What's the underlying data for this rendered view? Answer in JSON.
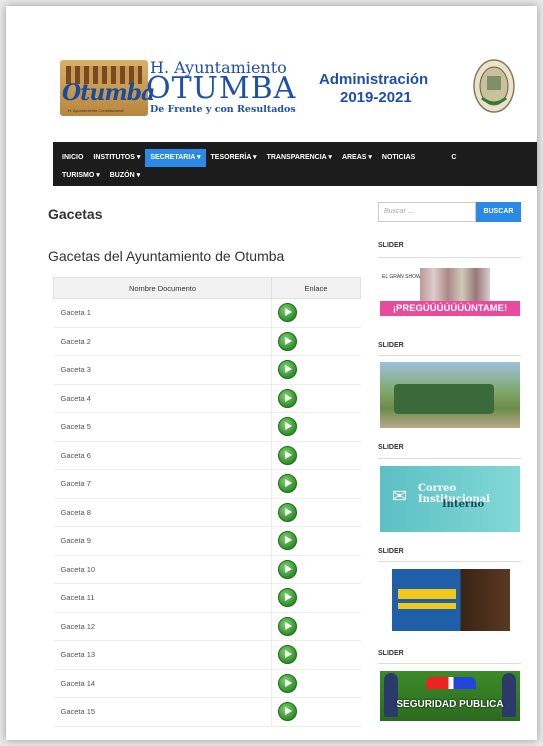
{
  "header": {
    "logo_script": "Otumba",
    "logo_small": "H. Ayuntamiento Constitucional",
    "ayuntamiento_line1": "H. Ayuntamiento",
    "ayuntamiento_line2": "OTUMBA",
    "ayuntamiento_slogan": "De Frente y con Resultados",
    "admin_line1": "Administración",
    "admin_line2": "2019-2021"
  },
  "nav": {
    "row1": [
      "INICIO",
      "INSTITUTOS ▾",
      "SECRETARIA ▾",
      "TESORERÍA ▾",
      "TRANSPARENCIA ▾",
      "AREAS ▾",
      "NOTICIAS",
      "C"
    ],
    "row2": [
      "TURISMO ▾",
      "BUZÓN ▾"
    ],
    "active": "SECRETARIA ▾"
  },
  "main": {
    "title": "Gacetas",
    "subtitle": "Gacetas del Ayuntamiento de Otumba",
    "table": {
      "headers": [
        "Nombre Documento",
        "Enlace"
      ],
      "rows": [
        "Gaceta 1",
        "Gaceta 2",
        "Gaceta 3",
        "Gaceta 4",
        "Gaceta 5",
        "Gaceta 6",
        "Gaceta 7",
        "Gaceta 8",
        "Gaceta 9",
        "Gaceta 10",
        "Gaceta 11",
        "Gaceta 12",
        "Gaceta 13",
        "Gaceta 14",
        "Gaceta 15"
      ]
    }
  },
  "sidebar": {
    "search_placeholder": "Buscar ...",
    "search_button": "BUSCAR",
    "slider_label": "SLIDER",
    "banner1_text": "EL GRAN SHOW PARA SABER",
    "banner1_bar": "¡PREGÚÚÚÚÚÚÚNTAME!",
    "banner3_line1": "Correo Institucional",
    "banner3_line2": "Interno",
    "banner5_text": "SEGURIDAD PUBLICA"
  },
  "colors": {
    "accent": "#2b8ae6",
    "nav_bg": "#1c1c1c",
    "brand_blue": "#1f4fa8",
    "pink": "#e84aa0"
  }
}
